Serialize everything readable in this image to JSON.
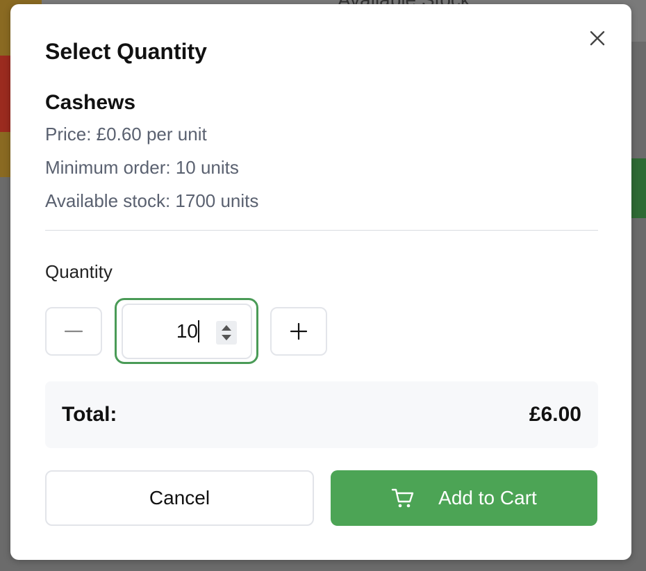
{
  "background": {
    "partial_heading": "Available Stock"
  },
  "modal": {
    "title": "Select Quantity",
    "close_icon": "close-icon"
  },
  "product": {
    "name": "Cashews",
    "price_text": "Price: £0.60 per unit",
    "min_order_text": "Minimum order: 10 units",
    "stock_text": "Available stock: 1700 units"
  },
  "quantity": {
    "label": "Quantity",
    "value": "10",
    "decrement_symbol": "−",
    "increment_symbol": "+"
  },
  "total": {
    "label": "Total:",
    "value": "£6.00"
  },
  "actions": {
    "cancel_label": "Cancel",
    "add_label": "Add to Cart",
    "add_icon": "cart-icon"
  },
  "colors": {
    "accent_green": "#4ca455",
    "focus_ring": "#4a9b57"
  }
}
